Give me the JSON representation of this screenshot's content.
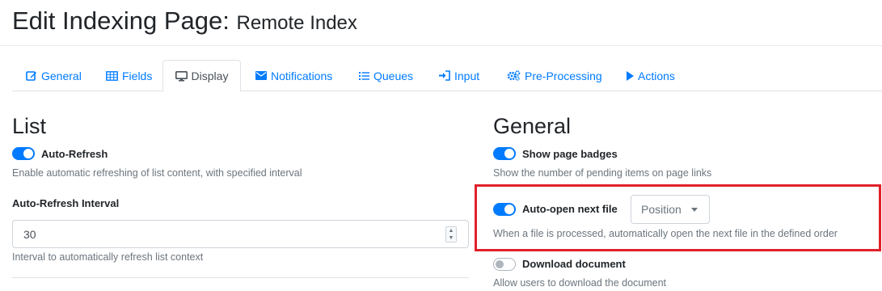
{
  "page": {
    "title": "Edit Indexing Page:",
    "subtitle": "Remote Index"
  },
  "tabs": [
    {
      "label": "General",
      "icon": "edit-icon",
      "active": false
    },
    {
      "label": "Fields",
      "icon": "table-icon",
      "active": false
    },
    {
      "label": "Display",
      "icon": "desktop-icon",
      "active": true
    },
    {
      "label": "Notifications",
      "icon": "envelope-icon",
      "active": false
    },
    {
      "label": "Queues",
      "icon": "list-icon",
      "active": false
    },
    {
      "label": "Input",
      "icon": "sign-in-icon",
      "active": false
    },
    {
      "label": "Pre-Processing",
      "icon": "cogs-icon",
      "active": false
    },
    {
      "label": "Actions",
      "icon": "play-icon",
      "active": false
    }
  ],
  "list": {
    "heading": "List",
    "auto_refresh": {
      "label": "Auto-Refresh",
      "enabled": true,
      "help": "Enable automatic refreshing of list content, with specified interval"
    },
    "interval": {
      "label": "Auto-Refresh Interval",
      "value": "30",
      "help": "Interval to automatically refresh list context"
    }
  },
  "general": {
    "heading": "General",
    "show_badges": {
      "label": "Show page badges",
      "enabled": true,
      "help": "Show the number of pending items on page links"
    },
    "auto_open": {
      "label": "Auto-open next file",
      "enabled": true,
      "order_selected": "Position",
      "help": "When a file is processed, automatically open the next file in the defined order"
    },
    "download": {
      "label": "Download document",
      "enabled": false,
      "help": "Allow users to download the document"
    }
  },
  "colors": {
    "accent": "#007bff",
    "highlight_border": "#e0202a",
    "muted_text": "#6c757d"
  }
}
